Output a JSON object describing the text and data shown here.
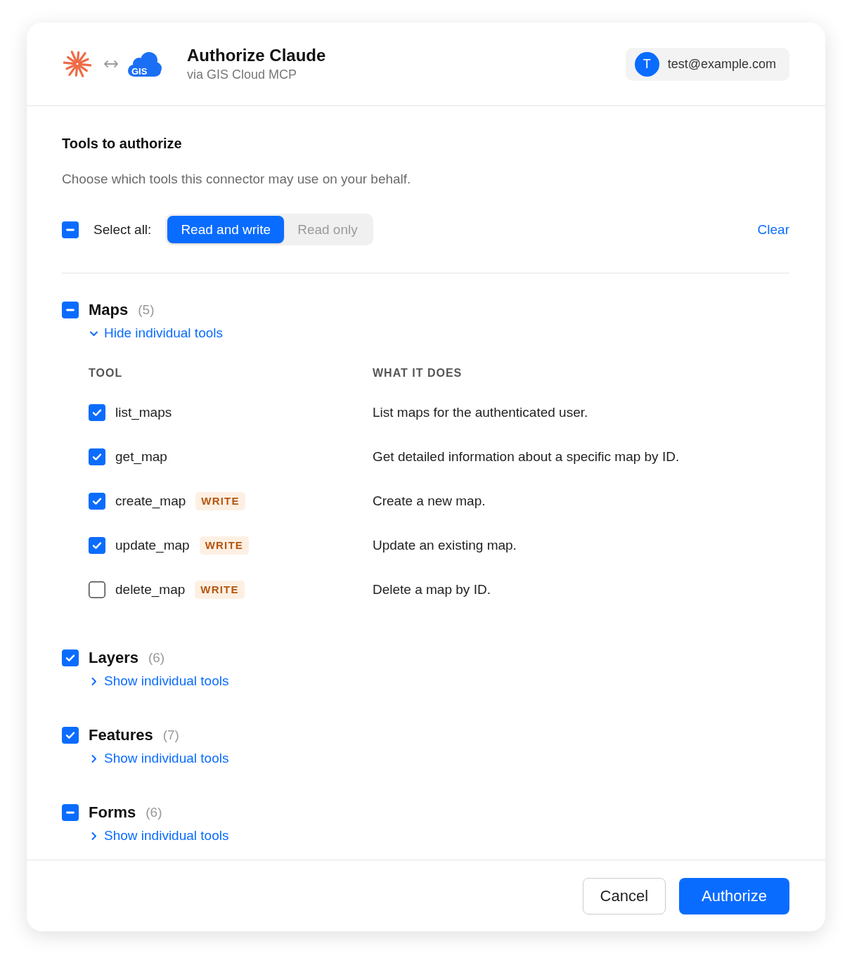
{
  "header": {
    "logo_text": "GIS",
    "title": "Authorize Claude",
    "subtitle": "via GIS Cloud MCP",
    "account": {
      "initial": "T",
      "email": "test@example.com"
    }
  },
  "section": {
    "title": "Tools to authorize",
    "description": "Choose which tools this connector may use on your behalf."
  },
  "select_all": {
    "label": "Select all:",
    "indeterminate": true,
    "modes": [
      {
        "label": "Read and write",
        "selected": true
      },
      {
        "label": "Read only",
        "selected": false
      }
    ],
    "clear": "Clear"
  },
  "groups": [
    {
      "name": "Maps",
      "count": "(5)",
      "indeterminate": true,
      "expanded": true,
      "toggle_label": "Hide individual tools",
      "columns": [
        "TOOL",
        "WHAT IT DOES"
      ],
      "tools": [
        {
          "name": "list_maps",
          "checked": true,
          "description": "List maps for the authenticated user."
        },
        {
          "name": "get_map",
          "checked": true,
          "description": "Get detailed information about a specific map by ID."
        },
        {
          "name": "create_map",
          "checked": true,
          "badge": "WRITE",
          "description": "Create a new map."
        },
        {
          "name": "update_map",
          "checked": true,
          "badge": "WRITE",
          "description": "Update an existing map."
        },
        {
          "name": "delete_map",
          "checked": false,
          "badge": "WRITE",
          "description": "Delete a map by ID."
        }
      ]
    },
    {
      "name": "Layers",
      "count": "(6)",
      "checked": true,
      "indeterminate": false,
      "expanded": false,
      "toggle_label": "Show individual tools"
    },
    {
      "name": "Features",
      "count": "(7)",
      "checked": true,
      "indeterminate": false,
      "expanded": false,
      "toggle_label": "Show individual tools"
    },
    {
      "name": "Forms",
      "count": "(6)",
      "indeterminate": true,
      "expanded": false,
      "toggle_label": "Show individual tools"
    }
  ],
  "footer": {
    "buttons": [
      {
        "label": "Cancel",
        "kind": "secondary"
      },
      {
        "label": "Authorize",
        "kind": "primary"
      }
    ]
  }
}
